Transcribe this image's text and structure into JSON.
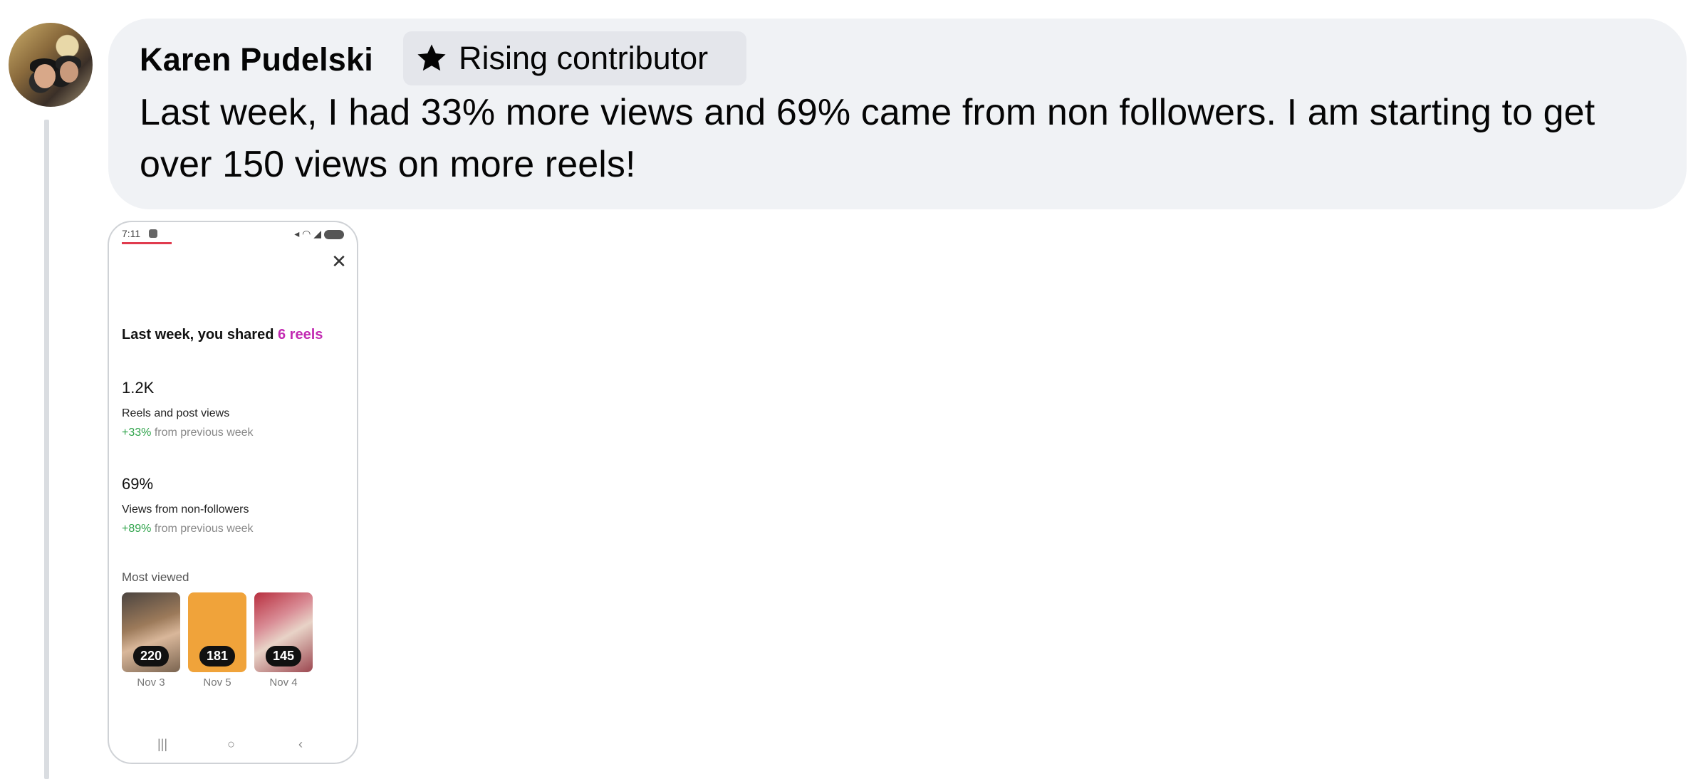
{
  "comment": {
    "author": "Karen Pudelski",
    "badge": {
      "icon": "star-icon",
      "label": "Rising contributor"
    },
    "text": "Last week, I had 33% more views and 69% came from non followers. I am starting to get over 150 views on more reels!"
  },
  "attachment": {
    "status_time": "7:11",
    "headline_prefix": "Last week, you shared ",
    "headline_accent": "6 reels",
    "accent_color": "#c22ab2",
    "stats": [
      {
        "value": "1.2K",
        "label": "Reels and post views",
        "change": "+33%",
        "change_suffix": " from previous week"
      },
      {
        "value": "69%",
        "label": "Views from non-followers",
        "change": "+89%",
        "change_suffix": " from previous week"
      }
    ],
    "most_viewed_label": "Most viewed",
    "reels": [
      {
        "count": "220",
        "date": "Nov 3"
      },
      {
        "count": "181",
        "date": "Nov 5"
      },
      {
        "count": "145",
        "date": "Nov 4"
      }
    ]
  }
}
